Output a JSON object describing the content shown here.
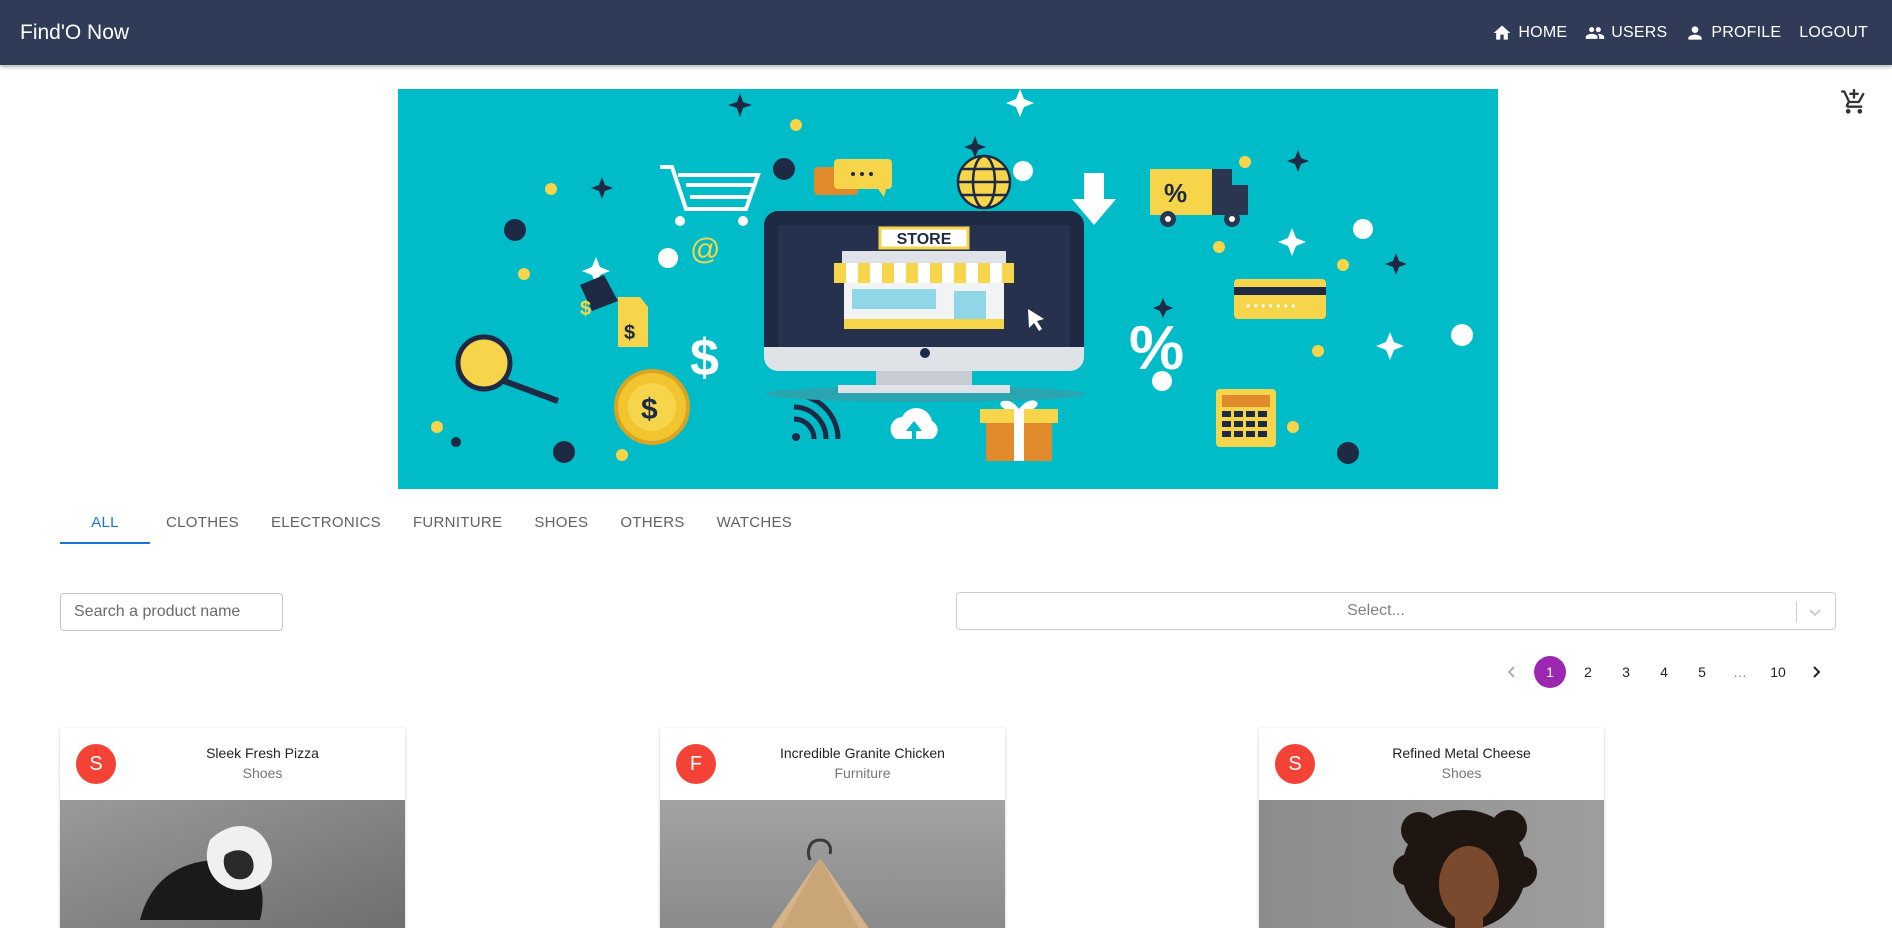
{
  "app": {
    "title": "Find'O Now"
  },
  "nav": {
    "items": [
      {
        "label": "HOME",
        "icon": "home-icon"
      },
      {
        "label": "USERS",
        "icon": "users-icon"
      },
      {
        "label": "PROFILE",
        "icon": "person-icon"
      },
      {
        "label": "LOGOUT",
        "icon": ""
      }
    ]
  },
  "banner": {
    "sign": "STORE"
  },
  "tabs": [
    "ALL",
    "CLOTHES",
    "ELECTRONICS",
    "FURNITURE",
    "SHOES",
    "OTHERS",
    "WATCHES"
  ],
  "active_tab": "ALL",
  "search": {
    "placeholder": "Search a product name"
  },
  "select": {
    "placeholder": "Select..."
  },
  "pagination": {
    "pages": [
      "1",
      "2",
      "3",
      "4",
      "5",
      "…",
      "10"
    ],
    "current": "1"
  },
  "products": [
    {
      "initial": "S",
      "name": "Sleek Fresh Pizza",
      "category": "Shoes"
    },
    {
      "initial": "F",
      "name": "Incredible Granite Chicken",
      "category": "Furniture"
    },
    {
      "initial": "S",
      "name": "Refined Metal Cheese",
      "category": "Shoes"
    }
  ],
  "colors": {
    "appbar": "#2f3b57",
    "tab_active": "#1976d2",
    "page_selected": "#9c27b0",
    "avatar": "#f44336",
    "banner_bg": "#00bcc9"
  }
}
